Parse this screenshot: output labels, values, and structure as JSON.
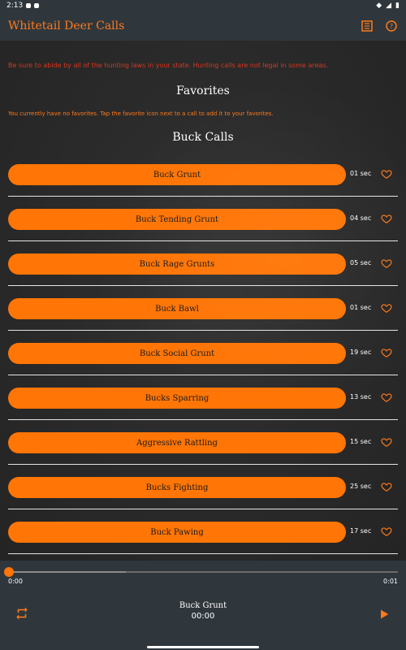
{
  "status_bar": {
    "time": "2:13"
  },
  "app_bar": {
    "title": "Whitetail Deer Calls",
    "actions": {
      "list_icon": "list-icon",
      "help_icon": "help-icon"
    }
  },
  "notice": {
    "text": "Be sure to abide by all of the hunting laws in your state. Hunting calls are not legal in some areas."
  },
  "favorites": {
    "heading": "Favorites",
    "empty_message": "You currently have no favorites. Tap the favorite icon next to a call to add it to your favorites."
  },
  "buck_calls": {
    "heading": "Buck Calls",
    "items": [
      {
        "name": "Buck Grunt",
        "duration": "01 sec"
      },
      {
        "name": "Buck Tending Grunt",
        "duration": "04 sec"
      },
      {
        "name": "Buck Rage Grunts",
        "duration": "05 sec"
      },
      {
        "name": "Buck Bawl",
        "duration": "01 sec"
      },
      {
        "name": "Buck Social Grunt",
        "duration": "19 sec"
      },
      {
        "name": "Bucks Sparring",
        "duration": "13 sec"
      },
      {
        "name": "Aggressive Rattling",
        "duration": "15 sec"
      },
      {
        "name": "Bucks Fighting",
        "duration": "25 sec"
      },
      {
        "name": "Buck Pawing",
        "duration": "17 sec"
      }
    ]
  },
  "player": {
    "current_time": "0:00",
    "total_time": "0:01",
    "track_title": "Buck Grunt",
    "elapsed": "00:00",
    "progress": 0,
    "buffered": 0.3
  },
  "colors": {
    "accent": "#ff7506",
    "title": "#ff7a1a",
    "warning": "#d8361f"
  }
}
